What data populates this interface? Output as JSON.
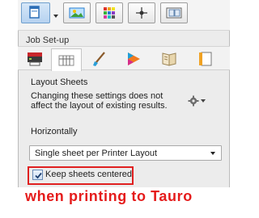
{
  "toolbar": {
    "buttons": [
      {
        "icon": "panel-window-icon",
        "active": true
      },
      {
        "icon": "image-picture-icon"
      },
      {
        "icon": "color-palette-icon"
      },
      {
        "icon": "crosshair-target-icon"
      },
      {
        "icon": "page-layout-icon"
      }
    ]
  },
  "section": {
    "title": "Job Set-up"
  },
  "tabs": [
    {
      "icon": "printer-icon"
    },
    {
      "icon": "layout-sheets-icon",
      "selected": true
    },
    {
      "icon": "brush-icon"
    },
    {
      "icon": "color-triangle-icon"
    },
    {
      "icon": "book-pages-icon"
    },
    {
      "icon": "page-edge-icon"
    }
  ],
  "layout_sheets": {
    "title": "Layout Sheets",
    "note": "Changing these settings does not affect the layout of existing results."
  },
  "horizontally": {
    "label": "Horizontally",
    "selected_value": "Single sheet per Printer Layout"
  },
  "keep_centered": {
    "label": "Keep sheets centered",
    "checked": true
  },
  "caption": "when printing to Tauro",
  "colors": {
    "caption": "#e51b1b",
    "highlight_border": "#e02020",
    "panel_background": "#ececec"
  }
}
